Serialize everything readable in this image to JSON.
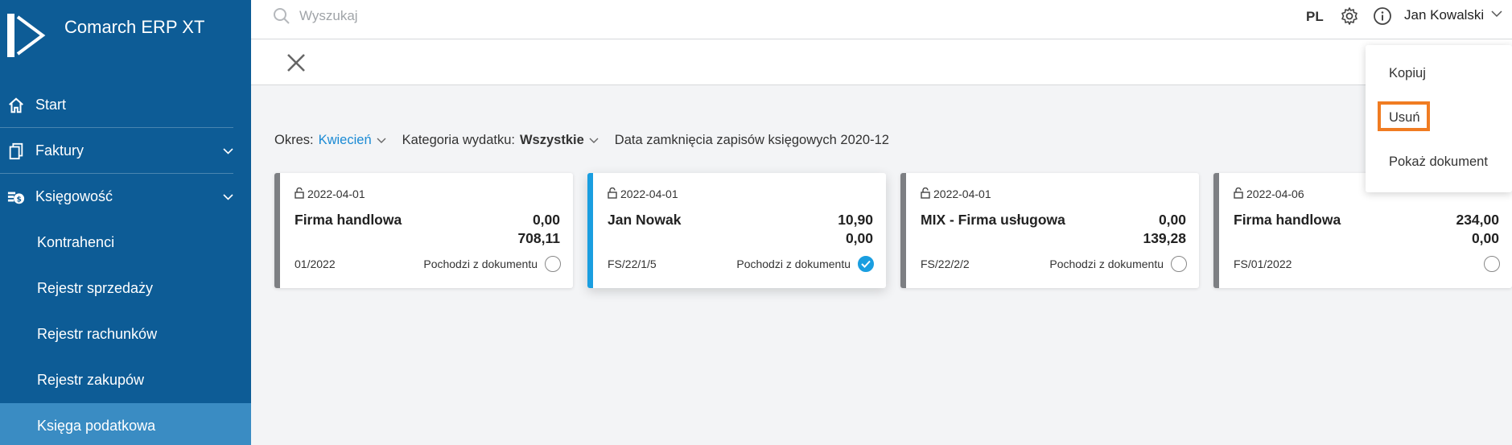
{
  "app": {
    "name": "Comarch ERP XT"
  },
  "topbar": {
    "search_placeholder": "Wyszukaj",
    "language": "PL",
    "user_name": "Jan Kowalski"
  },
  "sidebar": {
    "items": [
      {
        "label": "Start",
        "icon": "home-icon"
      },
      {
        "label": "Faktury",
        "icon": "documents-icon",
        "expandable": true
      },
      {
        "label": "Księgowość",
        "icon": "accounting-icon",
        "expandable": true
      },
      {
        "label": "Kontrahenci"
      },
      {
        "label": "Rejestr sprzedaży"
      },
      {
        "label": "Rejestr rachunków"
      },
      {
        "label": "Rejestr zakupów"
      },
      {
        "label": "Księga podatkowa",
        "active": true
      }
    ]
  },
  "filters": {
    "period_label": "Okres:",
    "period_value": "Kwiecień",
    "category_label": "Kategoria wydatku:",
    "category_value": "Wszystkie",
    "closing_date": "Data zamknięcia zapisów księgowych 2020-12"
  },
  "cards": [
    {
      "date": "2022-04-01",
      "name": "Firma handlowa",
      "value1": "0,00",
      "value2": "708,11",
      "doc": "01/2022",
      "source": "Pochodzi z dokumentu",
      "checked": false
    },
    {
      "date": "2022-04-01",
      "name": "Jan Nowak",
      "value1": "10,90",
      "value2": "0,00",
      "doc": "FS/22/1/5",
      "source": "Pochodzi z dokumentu",
      "checked": true
    },
    {
      "date": "2022-04-01",
      "name": "MIX - Firma usługowa",
      "value1": "0,00",
      "value2": "139,28",
      "doc": "FS/22/2/2",
      "source": "Pochodzi z dokumentu",
      "checked": false
    },
    {
      "date": "2022-04-06",
      "name": "Firma handlowa",
      "value1": "234,00",
      "value2": "0,00",
      "doc": "FS/01/2022",
      "source": "",
      "checked": false
    }
  ],
  "context_menu": {
    "items": [
      "Kopiuj",
      "Usuń",
      "Pokaż dokument"
    ],
    "highlighted": "Usuń"
  },
  "colors": {
    "sidebar": "#0d5c96",
    "sidebar_active": "#3a8cc3",
    "accent": "#1a9ee0",
    "highlight": "#f07c22"
  }
}
